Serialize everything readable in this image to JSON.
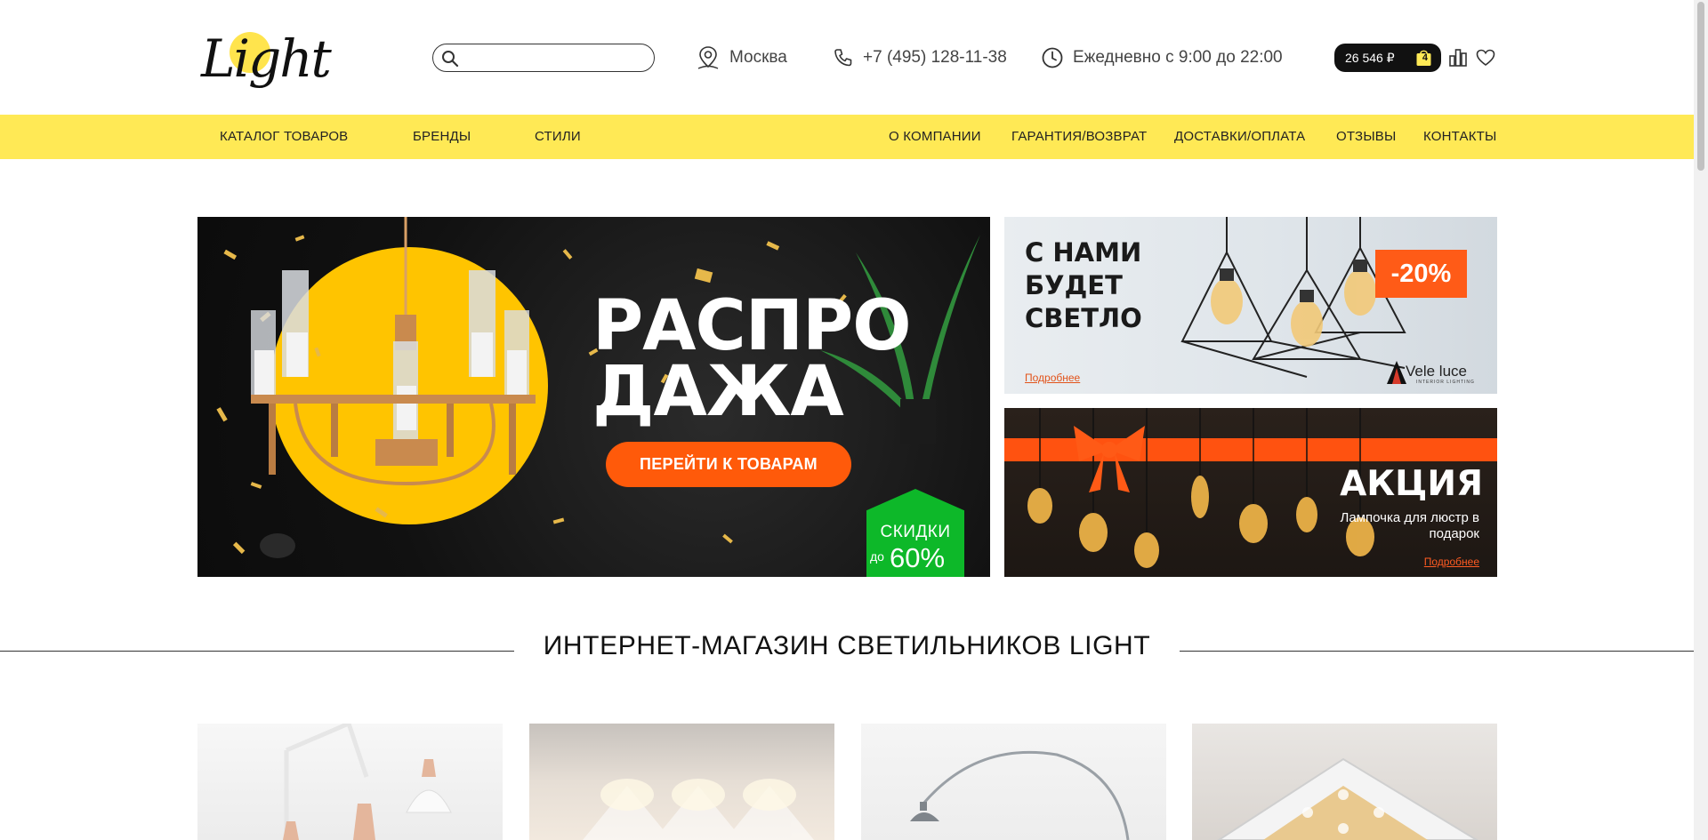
{
  "header": {
    "logo_text": "Light",
    "search": {
      "value": "",
      "placeholder": ""
    },
    "city": "Москва",
    "phone": "+7 (495) 128-11-38",
    "hours": "Ежедневно с 9:00 до 22:00",
    "cart": {
      "total": "26 546 ₽",
      "count": "4"
    }
  },
  "nav": {
    "left": [
      "КАТАЛОГ ТОВАРОВ",
      "БРЕНДЫ",
      "СТИЛИ"
    ],
    "right": [
      "О КОМПАНИИ",
      "ГАРАНТИЯ/ВОЗВРАТ",
      "ДОСТАВКИ/ОПЛАТА",
      "ОТЗЫВЫ",
      "КОНТАКТЫ"
    ]
  },
  "hero": {
    "title_line1": "РАСПРО",
    "title_line2": "ДАЖА",
    "cta": "ПЕРЕЙТИ К ТОВАРАМ",
    "badge": {
      "line1": "СКИДКИ",
      "prefix": "до",
      "value": "60%"
    }
  },
  "banner_top": {
    "line1": "С НАМИ",
    "line2": "БУДЕТ",
    "line3": "СВЕТЛО",
    "discount": "-20%",
    "more": "Подробнее",
    "brand": "Vele luce",
    "brand_sub": "INTERIOR LIGHTING"
  },
  "banner_bottom": {
    "title": "АКЦИЯ",
    "subtitle": "Лампочка для люстр в подарок",
    "more": "Подробнее"
  },
  "section": {
    "title": "ИНТЕРНЕТ-МАГАЗИН СВЕТИЛЬНИКОВ LIGHT"
  },
  "colors": {
    "accent_yellow": "#ffe955",
    "cta_orange": "#ff5a0a",
    "badge_green": "#0db829",
    "dark": "#111111"
  }
}
